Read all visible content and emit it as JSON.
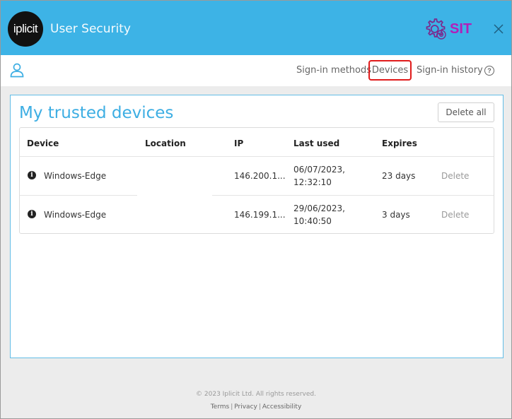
{
  "app": {
    "logo_text": "iplicit",
    "title": "User Security",
    "environment": "SIT",
    "colors": {
      "header": "#3db3e6",
      "accent": "#3daee3",
      "env": "#b21fb9",
      "highlight": "#e01b1b"
    }
  },
  "nav": {
    "items": [
      {
        "label": "Sign-in methods"
      },
      {
        "label": "Devices",
        "active": true
      },
      {
        "label": "Sign-in history"
      }
    ],
    "help_glyph": "?"
  },
  "panel": {
    "title": "My trusted devices",
    "delete_all_label": "Delete all",
    "table": {
      "columns": [
        "Device",
        "Location",
        "IP",
        "Last used",
        "Expires"
      ],
      "rows": [
        {
          "device": "Windows-Edge",
          "location": "",
          "ip": "146.200.1...",
          "last_used_date": "06/07/2023,",
          "last_used_time": "12:32:10",
          "expires": "23 days",
          "action": "Delete"
        },
        {
          "device": "Windows-Edge",
          "location": "",
          "ip": "146.199.1...",
          "last_used_date": "29/06/2023,",
          "last_used_time": "10:40:50",
          "expires": "3 days",
          "action": "Delete"
        }
      ]
    }
  },
  "footer": {
    "copyright": "© 2023 Iplicit Ltd. All rights reserved.",
    "links": [
      "Terms",
      "Privacy",
      "Accessibility"
    ]
  }
}
